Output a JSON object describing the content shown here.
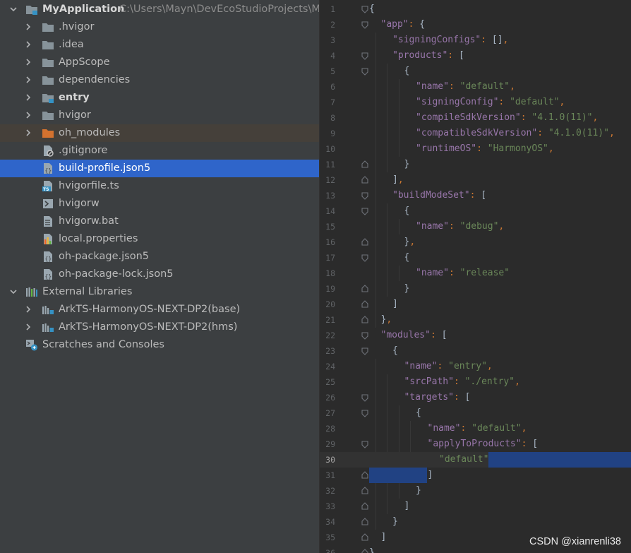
{
  "project_tree": {
    "root": {
      "label": "MyApplication",
      "path": "C:\\Users\\Mayn\\DevEcoStudioProjects\\MyA"
    },
    "items": [
      {
        "label": ".hvigor"
      },
      {
        "label": ".idea"
      },
      {
        "label": "AppScope"
      },
      {
        "label": "dependencies"
      },
      {
        "label": "entry"
      },
      {
        "label": "hvigor"
      },
      {
        "label": "oh_modules"
      },
      {
        "label": ".gitignore"
      },
      {
        "label": "build-profile.json5"
      },
      {
        "label": "hvigorfile.ts"
      },
      {
        "label": "hvigorw"
      },
      {
        "label": "hvigorw.bat"
      },
      {
        "label": "local.properties"
      },
      {
        "label": "oh-package.json5"
      },
      {
        "label": "oh-package-lock.json5"
      }
    ],
    "external_libraries": {
      "label": "External Libraries",
      "children": [
        {
          "label": "ArkTS-HarmonyOS-NEXT-DP2(base)"
        },
        {
          "label": "ArkTS-HarmonyOS-NEXT-DP2(hms)"
        }
      ]
    },
    "scratches": {
      "label": "Scratches and Consoles"
    }
  },
  "editor": {
    "current_line": 30,
    "lines": [
      {
        "n": "1",
        "t": [
          [
            "brace",
            "{"
          ]
        ]
      },
      {
        "n": "2",
        "t": [
          [
            "key",
            "\"app\""
          ],
          [
            "punc",
            ": "
          ],
          [
            "brace",
            "{"
          ]
        ]
      },
      {
        "n": "3",
        "t": [
          [
            "key",
            "\"signingConfigs\""
          ],
          [
            "punc",
            ": "
          ],
          [
            "brace",
            "[]"
          ],
          [
            "punc",
            ","
          ]
        ]
      },
      {
        "n": "4",
        "t": [
          [
            "key",
            "\"products\""
          ],
          [
            "punc",
            ": "
          ],
          [
            "brace",
            "["
          ]
        ]
      },
      {
        "n": "5",
        "t": [
          [
            "brace",
            "{"
          ]
        ]
      },
      {
        "n": "6",
        "t": [
          [
            "key",
            "\"name\""
          ],
          [
            "punc",
            ": "
          ],
          [
            "str",
            "\"default\""
          ],
          [
            "punc",
            ","
          ]
        ]
      },
      {
        "n": "7",
        "t": [
          [
            "key",
            "\"signingConfig\""
          ],
          [
            "punc",
            ": "
          ],
          [
            "str",
            "\"default\""
          ],
          [
            "punc",
            ","
          ]
        ]
      },
      {
        "n": "8",
        "t": [
          [
            "key",
            "\"compileSdkVersion\""
          ],
          [
            "punc",
            ": "
          ],
          [
            "str",
            "\"4.1.0(11)\""
          ],
          [
            "punc",
            ","
          ]
        ]
      },
      {
        "n": "9",
        "t": [
          [
            "key",
            "\"compatibleSdkVersion\""
          ],
          [
            "punc",
            ": "
          ],
          [
            "str",
            "\"4.1.0(11)\""
          ],
          [
            "punc",
            ","
          ]
        ]
      },
      {
        "n": "10",
        "t": [
          [
            "key",
            "\"runtimeOS\""
          ],
          [
            "punc",
            ": "
          ],
          [
            "str",
            "\"HarmonyOS\""
          ],
          [
            "punc",
            ","
          ]
        ]
      },
      {
        "n": "11",
        "t": [
          [
            "brace",
            "}"
          ]
        ]
      },
      {
        "n": "12",
        "t": [
          [
            "brace",
            "]"
          ],
          [
            "punc",
            ","
          ]
        ]
      },
      {
        "n": "13",
        "t": [
          [
            "key",
            "\"buildModeSet\""
          ],
          [
            "punc",
            ": "
          ],
          [
            "brace",
            "["
          ]
        ]
      },
      {
        "n": "14",
        "t": [
          [
            "brace",
            "{"
          ]
        ]
      },
      {
        "n": "15",
        "t": [
          [
            "key",
            "\"name\""
          ],
          [
            "punc",
            ": "
          ],
          [
            "str",
            "\"debug\""
          ],
          [
            "punc",
            ","
          ]
        ]
      },
      {
        "n": "16",
        "t": [
          [
            "brace",
            "}"
          ],
          [
            "punc",
            ","
          ]
        ]
      },
      {
        "n": "17",
        "t": [
          [
            "brace",
            "{"
          ]
        ]
      },
      {
        "n": "18",
        "t": [
          [
            "key",
            "\"name\""
          ],
          [
            "punc",
            ": "
          ],
          [
            "str",
            "\"release\""
          ]
        ]
      },
      {
        "n": "19",
        "t": [
          [
            "brace",
            "}"
          ]
        ]
      },
      {
        "n": "20",
        "t": [
          [
            "brace",
            "]"
          ]
        ]
      },
      {
        "n": "21",
        "t": [
          [
            "brace",
            "}"
          ],
          [
            "punc",
            ","
          ]
        ]
      },
      {
        "n": "22",
        "t": [
          [
            "key",
            "\"modules\""
          ],
          [
            "punc",
            ": "
          ],
          [
            "brace",
            "["
          ]
        ]
      },
      {
        "n": "23",
        "t": [
          [
            "brace",
            "{"
          ]
        ]
      },
      {
        "n": "24",
        "t": [
          [
            "key",
            "\"name\""
          ],
          [
            "punc",
            ": "
          ],
          [
            "str",
            "\"entry\""
          ],
          [
            "punc",
            ","
          ]
        ]
      },
      {
        "n": "25",
        "t": [
          [
            "key",
            "\"srcPath\""
          ],
          [
            "punc",
            ": "
          ],
          [
            "str",
            "\"./entry\""
          ],
          [
            "punc",
            ","
          ]
        ]
      },
      {
        "n": "26",
        "t": [
          [
            "key",
            "\"targets\""
          ],
          [
            "punc",
            ": "
          ],
          [
            "brace",
            "["
          ]
        ]
      },
      {
        "n": "27",
        "t": [
          [
            "brace",
            "{"
          ]
        ]
      },
      {
        "n": "28",
        "t": [
          [
            "key",
            "\"name\""
          ],
          [
            "punc",
            ": "
          ],
          [
            "str",
            "\"default\""
          ],
          [
            "punc",
            ","
          ]
        ]
      },
      {
        "n": "29",
        "t": [
          [
            "key",
            "\"applyToProducts\""
          ],
          [
            "punc",
            ": "
          ],
          [
            "brace",
            "["
          ]
        ]
      },
      {
        "n": "30",
        "t": [
          [
            "str",
            "\"default\""
          ]
        ]
      },
      {
        "n": "31",
        "t": [
          [
            "brace",
            "]"
          ]
        ]
      },
      {
        "n": "32",
        "t": [
          [
            "brace",
            "}"
          ]
        ]
      },
      {
        "n": "33",
        "t": [
          [
            "brace",
            "]"
          ]
        ]
      },
      {
        "n": "34",
        "t": [
          [
            "brace",
            "}"
          ]
        ]
      },
      {
        "n": "35",
        "t": [
          [
            "brace",
            "]"
          ]
        ]
      },
      {
        "n": "36",
        "t": [
          [
            "brace",
            "}"
          ]
        ]
      }
    ]
  },
  "watermark": "CSDN @xianrenli38",
  "colors": {
    "selection": "#2f65ca",
    "editor_selection": "#214283",
    "folder": "#87939a",
    "excluded_folder": "#d4722f",
    "module_badge": "#3592c4"
  }
}
